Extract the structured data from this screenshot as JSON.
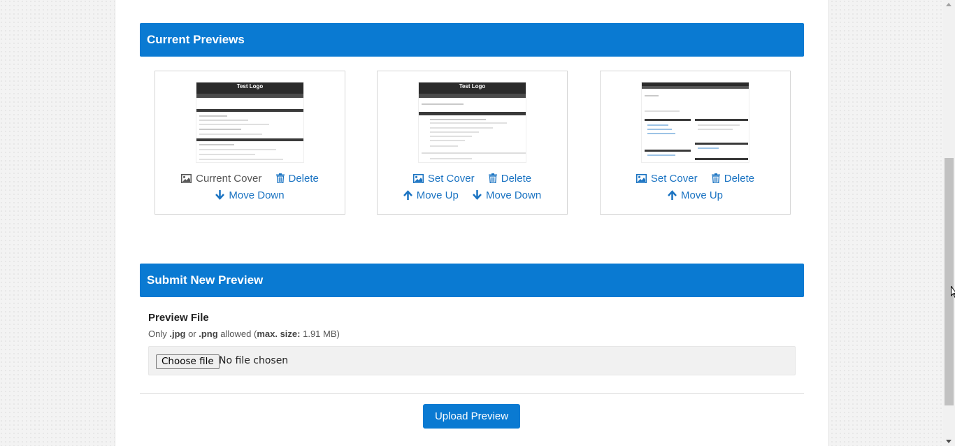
{
  "current_previews": {
    "title": "Current Previews",
    "cards": [
      {
        "thumb_logo": "Test Logo",
        "row1": [
          {
            "label": "Current Cover",
            "icon": "image-icon"
          },
          {
            "label": "Delete",
            "icon": "trash-icon"
          }
        ],
        "row2": [
          {
            "label": "Move Down",
            "icon": "arrow-down-icon"
          }
        ]
      },
      {
        "thumb_logo": "Test Logo",
        "row1": [
          {
            "label": "Set Cover",
            "icon": "image-icon"
          },
          {
            "label": "Delete",
            "icon": "trash-icon"
          }
        ],
        "row2": [
          {
            "label": "Move Up",
            "icon": "arrow-up-icon"
          },
          {
            "label": "Move Down",
            "icon": "arrow-down-icon"
          }
        ]
      },
      {
        "thumb_logo": "",
        "row1": [
          {
            "label": "Set Cover",
            "icon": "image-icon"
          },
          {
            "label": "Delete",
            "icon": "trash-icon"
          }
        ],
        "row2": [
          {
            "label": "Move Up",
            "icon": "arrow-up-icon"
          }
        ]
      }
    ]
  },
  "submit_preview": {
    "title": "Submit New Preview",
    "field_label": "Preview File",
    "hint": {
      "prefix": "Only ",
      "ext1": ".jpg",
      "or": " or ",
      "ext2": ".png",
      "allowed": " allowed (",
      "max_label": "max. size:",
      "max_value": " 1.91 MB)"
    },
    "choose_button": "Choose file",
    "no_file_text": "No file chosen",
    "upload_button": "Upload Preview"
  },
  "colors": {
    "accent": "#0a7ad2",
    "link": "#1a73c2"
  }
}
